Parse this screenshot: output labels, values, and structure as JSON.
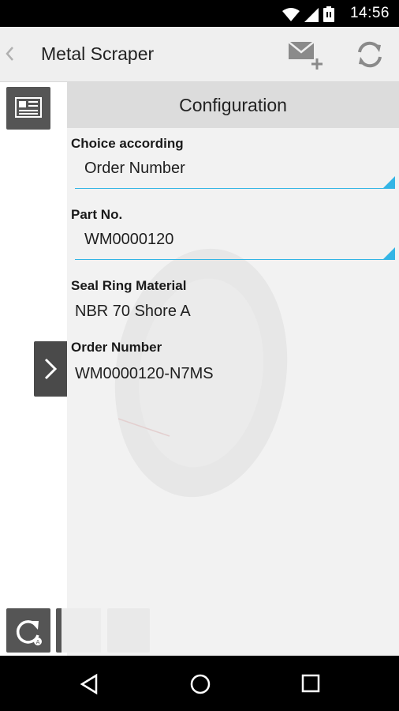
{
  "status_bar": {
    "time": "14:56"
  },
  "action_bar": {
    "title": "Metal Scraper"
  },
  "panel": {
    "header": "Configuration",
    "choice_label": "Choice according",
    "choice_value": "Order Number",
    "part_label": "Part No.",
    "part_value": "WM0000120",
    "material_label": "Seal Ring Material",
    "material_value": "NBR 70 Shore A",
    "order_label": "Order Number",
    "order_value": "WM0000120-N7MS"
  },
  "colors": {
    "accent": "#33b5e5",
    "dark_button": "#555555",
    "header_bg": "#dcdcdc"
  },
  "icons": [
    "wifi-icon",
    "signal-icon",
    "battery-icon",
    "back-chevron-icon",
    "mail-add-icon",
    "refresh-icon",
    "document-icon",
    "chevron-right-icon",
    "reload-icon",
    "nav-back-icon",
    "nav-home-icon",
    "nav-recents-icon"
  ]
}
